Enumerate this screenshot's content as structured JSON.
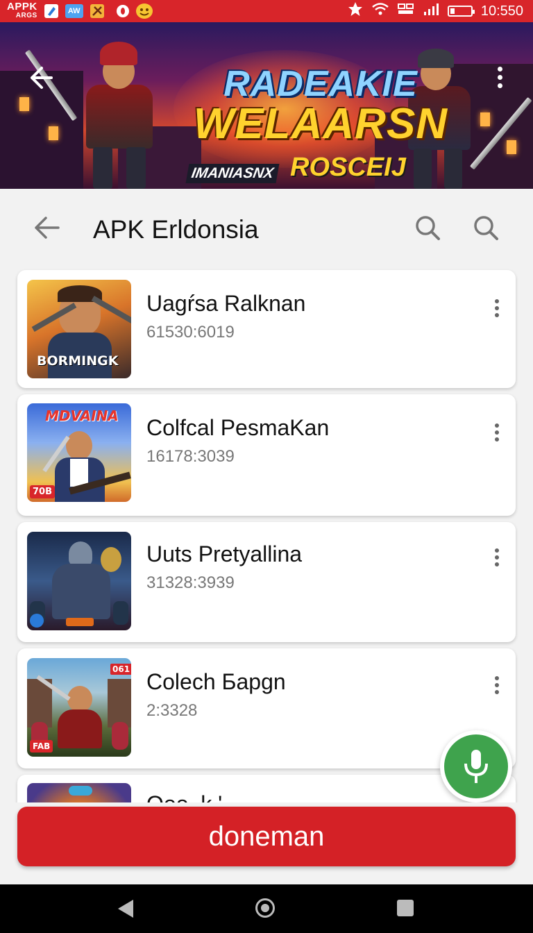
{
  "status_bar": {
    "app_label": "APPK",
    "app_sublabel": "ARGS",
    "icon_badge_text": "AW",
    "time": "10:550",
    "battery_level": 0.2,
    "bg_color": "#d8252a"
  },
  "banner": {
    "title_line1": "RADEAKIE",
    "title_line2": "WELAARSN",
    "tag_left": "IMANIASNX",
    "tag_right": "ROSCEIJ"
  },
  "app_bar": {
    "title": "APK Erldonsia"
  },
  "list": {
    "items": [
      {
        "title": "Uagŕsa Ralknan",
        "subtitle": "61530:6019",
        "thumb_label": "BORMINGK",
        "thumb_icon": "soldier-art"
      },
      {
        "title": "Colfcal PesmaKan",
        "subtitle": "16178:3039",
        "thumb_label": "MDVAINA",
        "thumb_badge": "70B",
        "thumb_icon": "agent-art"
      },
      {
        "title": "Uuts Pretyallina",
        "subtitle": "31328:3939",
        "thumb_icon": "robot-knight-art"
      },
      {
        "title": "Colech Бapgn",
        "subtitle": "2:3328",
        "thumb_badge": "FAB",
        "thumb_badge_top": "061",
        "thumb_icon": "hero-art"
      },
      {
        "title": "Ooo..k.'",
        "subtitle": "",
        "thumb_icon": "tiger-art"
      }
    ]
  },
  "fab": {
    "icon": "microphone-icon",
    "color": "#3fa34d"
  },
  "primary_button": {
    "label": "doneman",
    "color": "#d42126"
  },
  "nav_bar": {
    "back": "back-icon",
    "home": "home-icon",
    "recents": "recents-icon"
  }
}
